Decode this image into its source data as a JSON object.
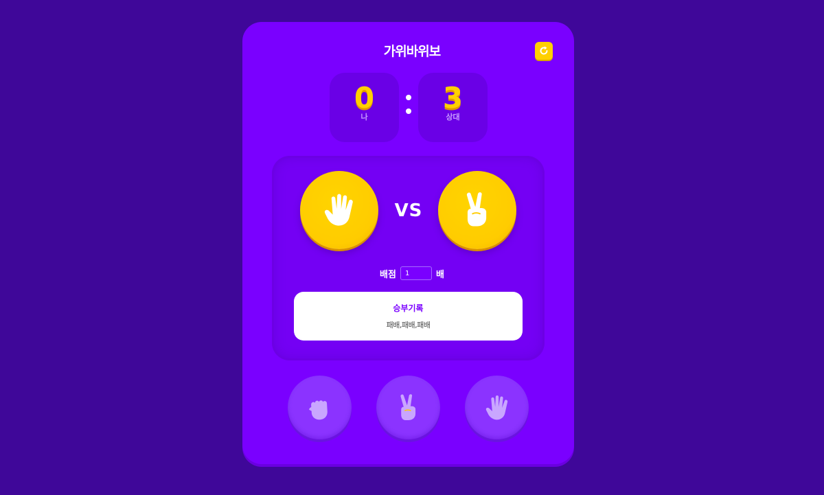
{
  "header": {
    "title": "가위바위보",
    "reset_icon": "refresh-icon"
  },
  "score": {
    "me": {
      "value": "0",
      "label": "나"
    },
    "opponent": {
      "value": "3",
      "label": "상대"
    },
    "separator": ":"
  },
  "arena": {
    "my_hand": "paper",
    "opponent_hand": "scissors",
    "vs_label": "VS"
  },
  "bet": {
    "label": "배점",
    "value": "1",
    "unit": "배"
  },
  "history": {
    "title": "승부기록",
    "text": "패배,패배,패배"
  },
  "choices": [
    {
      "name": "rock",
      "icon": "fist-icon"
    },
    {
      "name": "scissors",
      "icon": "victory-hand-icon"
    },
    {
      "name": "paper",
      "icon": "open-hand-icon"
    }
  ],
  "colors": {
    "background": "#3f0799",
    "card": "#7a00ff",
    "accent": "#ffd000",
    "score_box": "#6a00e6",
    "choice_button": "#8b33ff"
  }
}
